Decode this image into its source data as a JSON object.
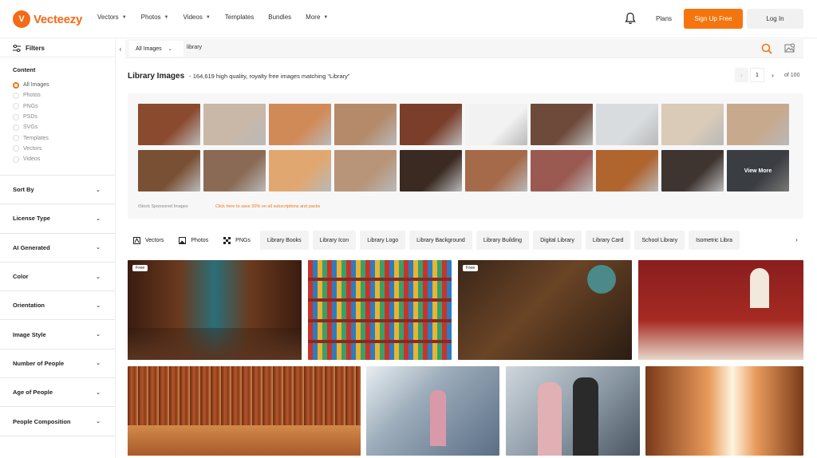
{
  "header": {
    "logo_mark": "V",
    "logo_text": "Vecteezy",
    "nav": [
      {
        "label": "Vectors",
        "dropdown": true
      },
      {
        "label": "Photos",
        "dropdown": true
      },
      {
        "label": "Videos",
        "dropdown": true
      },
      {
        "label": "Templates",
        "dropdown": false
      },
      {
        "label": "Bundles",
        "dropdown": false
      },
      {
        "label": "More",
        "dropdown": true
      }
    ],
    "plans": "Plans",
    "signup": "Sign Up Free",
    "login": "Log In",
    "brand_color": "#f4750f"
  },
  "sidebar": {
    "filters_label": "Filters",
    "content_title": "Content",
    "content_options": [
      "All Images",
      "Photos",
      "PNGs",
      "PSDs",
      "SVGs",
      "Templates",
      "Vectors",
      "Videos"
    ],
    "selected_option": "All Images",
    "facets": [
      "Sort By",
      "License Type",
      "AI Generated",
      "Color",
      "Orientation",
      "Image Style",
      "Number of People",
      "Age of People",
      "People Composition"
    ]
  },
  "search": {
    "type": "All Images",
    "query": "library"
  },
  "results": {
    "title": "Library Images",
    "subtitle": "- 164,619 high quality, royalty free images matching “Library”",
    "page": "1",
    "of_pages": "of 100"
  },
  "sponsored": {
    "view_more": "View More",
    "note": "iStock   Sponsored Images",
    "promo": "Click here to save 20% on all subscriptions and packs",
    "row1": [
      "#8a4a2e",
      "#c9b8a8",
      "#d08a58",
      "#b48a6a",
      "#7a3e2a",
      "#f2f2f2",
      "#6e4a3a",
      "#d8dcdf",
      "#d9cbb8",
      "#c7a98e"
    ],
    "row2": [
      "#7a5034",
      "#8a6a54",
      "#e0a870",
      "#b89478",
      "#3a2a22",
      "#a56a4a",
      "#9a5a52",
      "#b0642e",
      "#3e3430",
      "#5a5e66"
    ]
  },
  "chips": {
    "type_chips": [
      "Vectors",
      "Photos",
      "PNGs"
    ],
    "tag_chips": [
      "Library Books",
      "Library Icon",
      "Library Logo",
      "Library Background",
      "Library Building",
      "Digital Library",
      "Library Card",
      "School Library",
      "Isometric Libra"
    ]
  },
  "grid": {
    "free_badge": "Free"
  }
}
